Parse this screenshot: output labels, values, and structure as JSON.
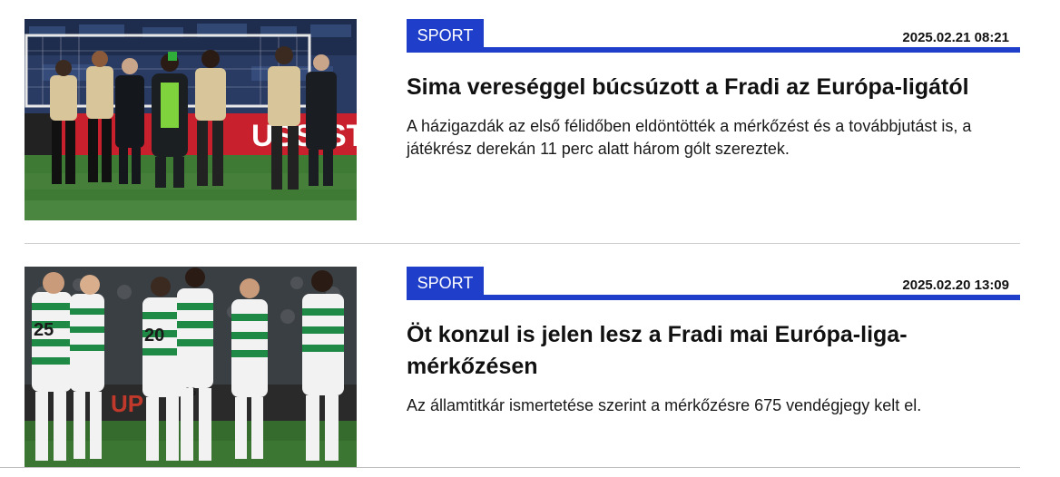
{
  "articles": [
    {
      "category": "SPORT",
      "datetime": "2025.02.21 08:21",
      "title": "Sima vereséggel búcsúzott a Fradi az Európa-ligától",
      "lead": "A házigazdák az első félidőben eldöntötték a mérkőzést és a továbbjutást is, a játékrész derekán 11 perc alatt három gólt szereztek.",
      "image_desc": "football-players-beige-kit-walking"
    },
    {
      "category": "SPORT",
      "datetime": "2025.02.20 13:09",
      "title": "Öt konzul is jelen lesz a Fradi mai Európa-liga-mérkőzésen",
      "lead": "Az államtitkár ismertetése szerint a mérkőzésre 675 vendégjegy kelt el.",
      "image_desc": "football-players-green-white-kit-celebrating"
    }
  ],
  "colors": {
    "accent": "#1f3ec9",
    "text": "#111111",
    "pitch": "#3f7a34",
    "green_kit": "#1f8a45",
    "beige_kit": "#d8c59a"
  }
}
